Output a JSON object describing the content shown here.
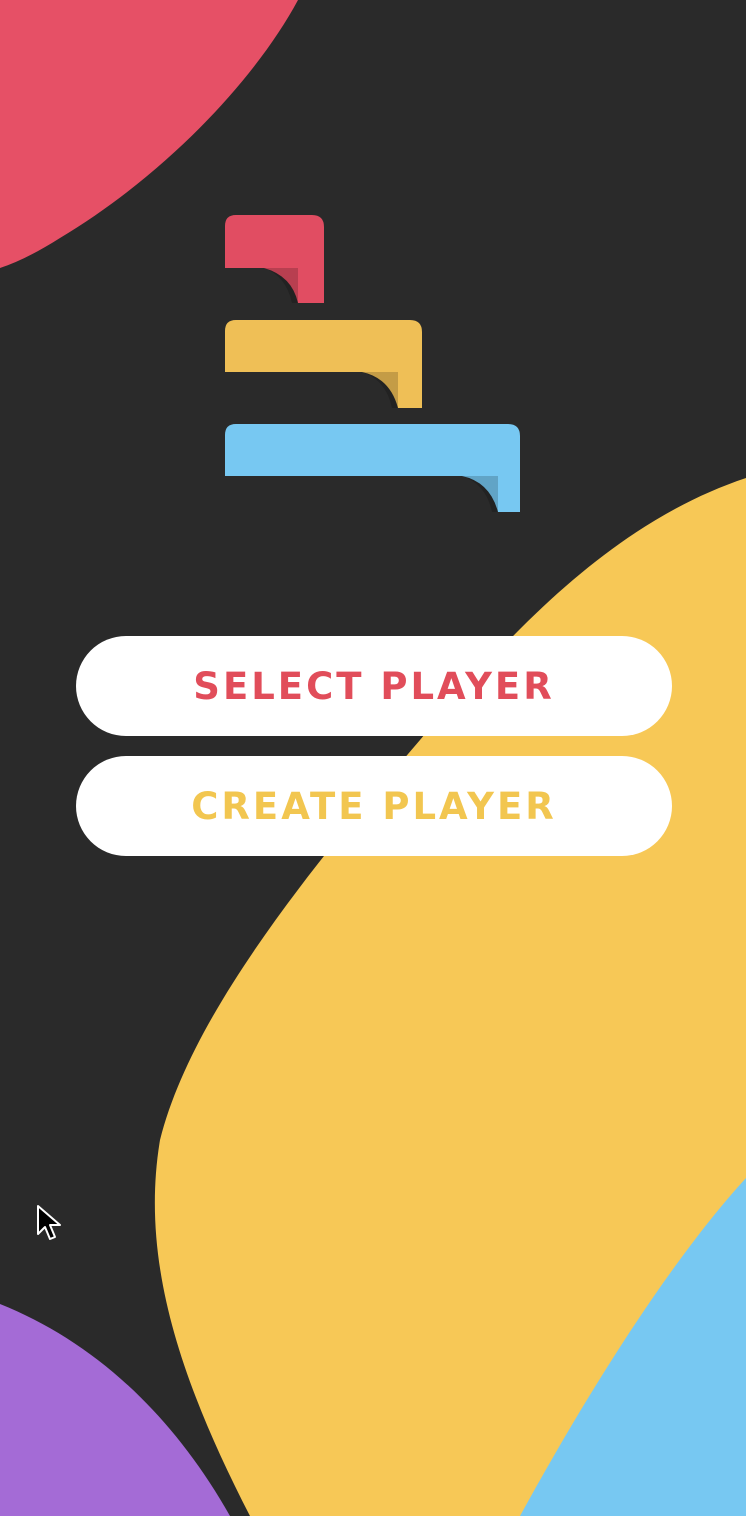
{
  "screen": {
    "background_color": "#2a2a2a",
    "decorative_shapes": {
      "top_left_blob_color": "#e65066",
      "center_right_blob_color": "#f7c856",
      "bottom_right_blob_color": "#77c8f2",
      "bottom_left_blob_color": "#a46bd6"
    }
  },
  "logo": {
    "icon": "stacked-steps-logo-icon",
    "colors": {
      "top": "#e14d62",
      "middle": "#efbf56",
      "bottom": "#77c8f2"
    }
  },
  "menu": {
    "select_player": {
      "label": "SELECT PLAYER",
      "text_color": "#e14d5a"
    },
    "create_player": {
      "label": "CREATE PLAYER",
      "text_color": "#f2c650"
    }
  },
  "cursor": {
    "icon": "mouse-pointer-icon"
  }
}
